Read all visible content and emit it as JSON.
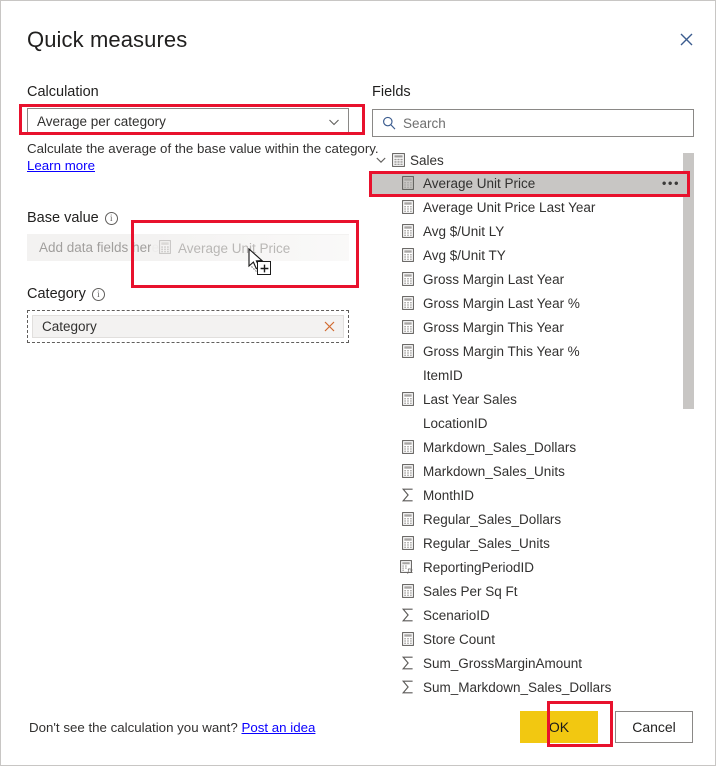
{
  "dialog": {
    "title": "Quick measures",
    "close_icon": "close-icon"
  },
  "calculation": {
    "label": "Calculation",
    "selected": "Average per category",
    "chevron_icon": "chevron-down-icon",
    "description": "Calculate the average of the base value within the category.",
    "learn_more": "Learn more",
    "highlighted": true
  },
  "base_value": {
    "label": "Base value",
    "info_icon": "info-icon",
    "placeholder": "Add data fields here",
    "drag_ghost": {
      "field": "Average Unit Price",
      "icon": "measure-calculator-icon",
      "cursor_icon": "drag-cursor-icon",
      "drop_badge": "plus-icon"
    },
    "highlighted": true
  },
  "category": {
    "label": "Category",
    "info_icon": "info-icon",
    "chip": "Category",
    "remove_icon": "close-icon"
  },
  "fields": {
    "label": "Fields",
    "search": {
      "placeholder": "Search",
      "icon": "search-icon",
      "value": ""
    },
    "tree": {
      "expander_icon": "chevron-down-icon",
      "table_icon": "table-icon",
      "table_name": "Sales",
      "expanded": true
    },
    "selected_field": "Average Unit Price",
    "overflow_icon": "ellipsis-icon",
    "items": [
      {
        "name": "Average Unit Price",
        "icon": "measure-calculator-icon",
        "selected": true,
        "overflow": true
      },
      {
        "name": "Average Unit Price Last Year",
        "icon": "measure-calculator-icon",
        "selected": false,
        "overflow": false
      },
      {
        "name": "Avg $/Unit LY",
        "icon": "measure-calculator-icon",
        "selected": false,
        "overflow": false
      },
      {
        "name": "Avg $/Unit TY",
        "icon": "measure-calculator-icon",
        "selected": false,
        "overflow": false
      },
      {
        "name": "Gross Margin Last Year",
        "icon": "measure-calculator-icon",
        "selected": false,
        "overflow": false
      },
      {
        "name": "Gross Margin Last Year %",
        "icon": "measure-calculator-icon",
        "selected": false,
        "overflow": false
      },
      {
        "name": "Gross Margin This Year",
        "icon": "measure-calculator-icon",
        "selected": false,
        "overflow": false
      },
      {
        "name": "Gross Margin This Year %",
        "icon": "measure-calculator-icon",
        "selected": false,
        "overflow": false
      },
      {
        "name": "ItemID",
        "icon": "none",
        "selected": false,
        "overflow": false
      },
      {
        "name": "Last Year Sales",
        "icon": "measure-calculator-icon",
        "selected": false,
        "overflow": false
      },
      {
        "name": "LocationID",
        "icon": "none",
        "selected": false,
        "overflow": false
      },
      {
        "name": "Markdown_Sales_Dollars",
        "icon": "measure-calculator-icon",
        "selected": false,
        "overflow": false
      },
      {
        "name": "Markdown_Sales_Units",
        "icon": "measure-calculator-icon",
        "selected": false,
        "overflow": false
      },
      {
        "name": "MonthID",
        "icon": "sigma-icon",
        "selected": false,
        "overflow": false
      },
      {
        "name": "Regular_Sales_Dollars",
        "icon": "measure-calculator-icon",
        "selected": false,
        "overflow": false
      },
      {
        "name": "Regular_Sales_Units",
        "icon": "measure-calculator-icon",
        "selected": false,
        "overflow": false
      },
      {
        "name": "ReportingPeriodID",
        "icon": "calculated-column-icon",
        "selected": false,
        "overflow": false
      },
      {
        "name": "Sales Per Sq Ft",
        "icon": "measure-calculator-icon",
        "selected": false,
        "overflow": false
      },
      {
        "name": "ScenarioID",
        "icon": "sigma-icon",
        "selected": false,
        "overflow": false
      },
      {
        "name": "Store Count",
        "icon": "measure-calculator-icon",
        "selected": false,
        "overflow": false
      },
      {
        "name": "Sum_GrossMarginAmount",
        "icon": "sigma-icon",
        "selected": false,
        "overflow": false
      },
      {
        "name": "Sum_Markdown_Sales_Dollars",
        "icon": "sigma-icon",
        "selected": false,
        "overflow": false
      }
    ]
  },
  "footer": {
    "note_text": "Don't see the calculation you want?",
    "note_link": "Post an idea",
    "ok_label": "OK",
    "cancel_label": "Cancel",
    "ok_highlighted": true
  },
  "colors": {
    "annotation_red": "#e8112d",
    "ok_yellow": "#f2c811",
    "link_blue": "#0a00ff",
    "selection_gray": "#c8c6c4",
    "dropzone_gray": "#f3f2f1"
  }
}
